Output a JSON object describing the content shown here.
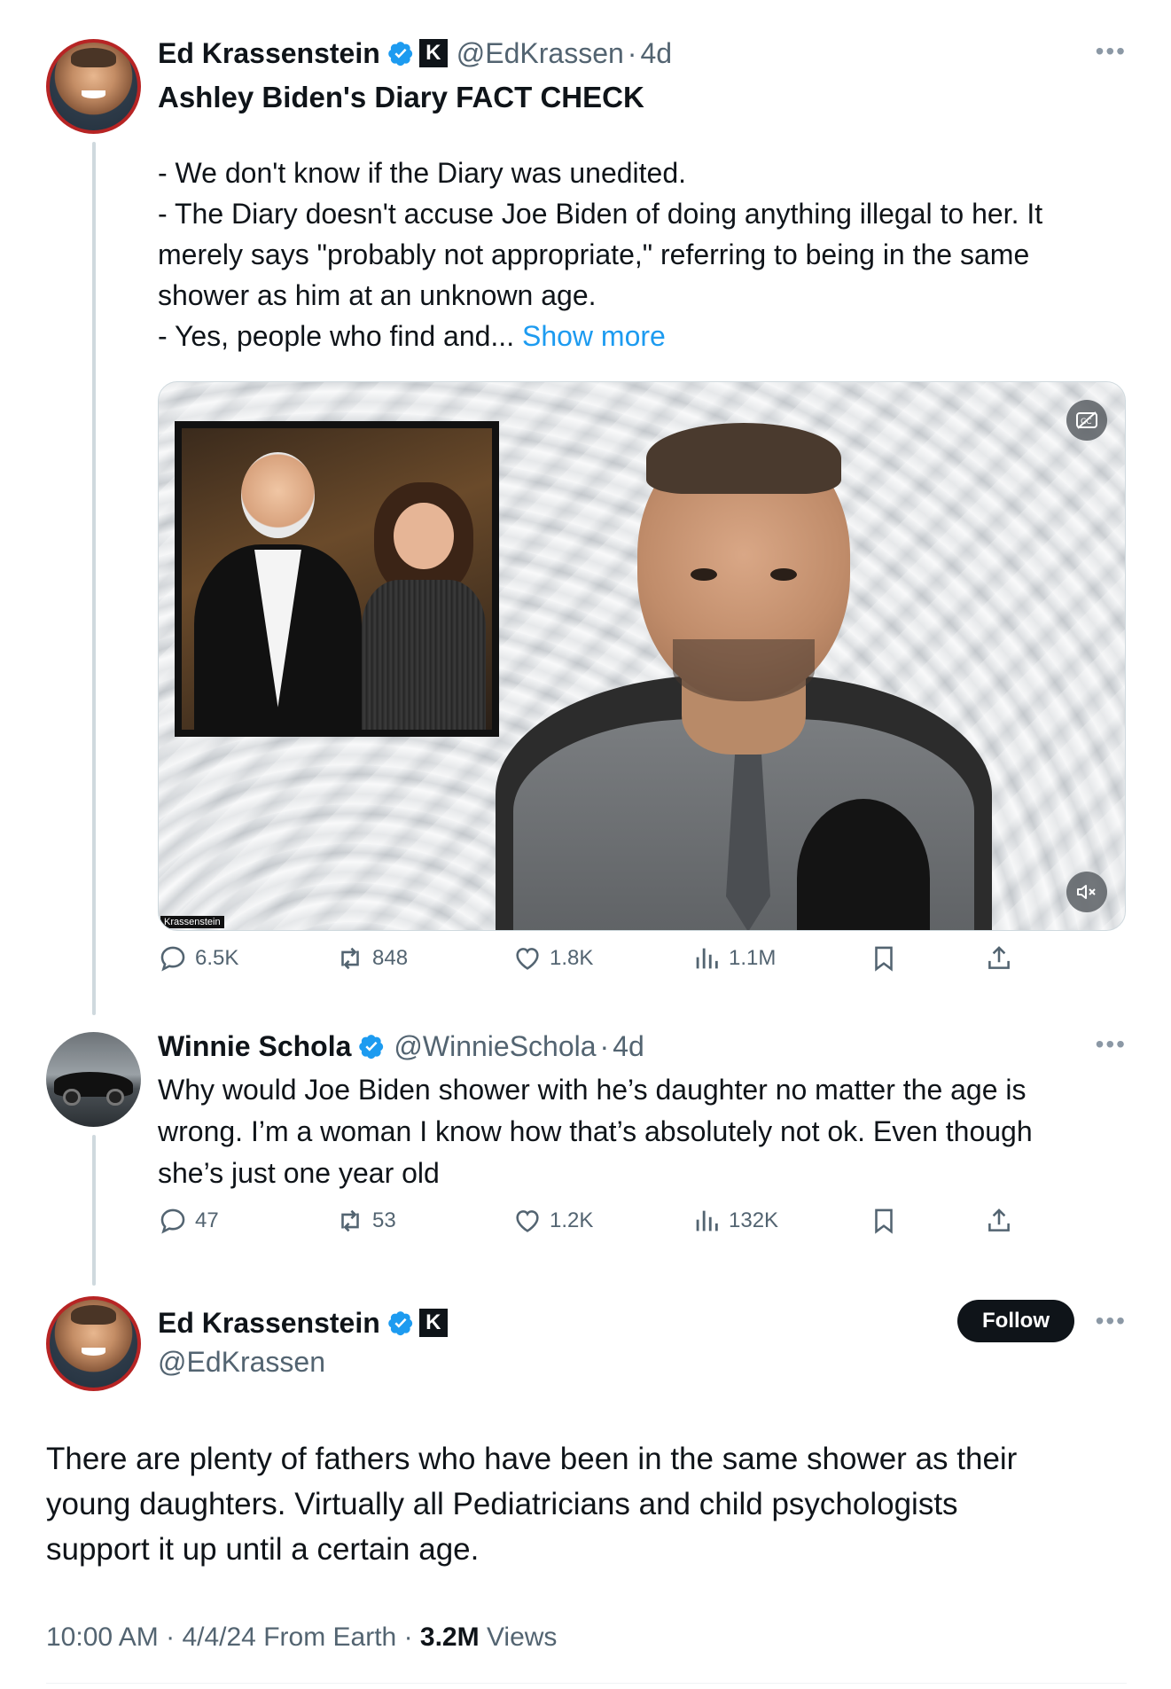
{
  "tweet1": {
    "name": "Ed Krassenstein",
    "handle": "@EdKrassen",
    "sep": "·",
    "time": "4d",
    "title": "Ashley Biden's Diary FACT CHECK",
    "body_lines": [
      "- We don't know if the Diary was unedited.",
      "- The Diary doesn't accuse Joe Biden of doing anything illegal to her. It",
      "merely says \"probably not appropriate,\" referring to being in the same",
      "shower as him at an unknown age.",
      "- Yes, people who find and... "
    ],
    "show_more": "Show more",
    "media": {
      "watermark": "Krassenstein"
    },
    "stats": {
      "replies": "6.5K",
      "reposts": "848",
      "likes": "1.8K",
      "views": "1.1M"
    }
  },
  "tweet2": {
    "name": "Winnie Schola",
    "handle": "@WinnieSchola",
    "sep": "·",
    "time": "4d",
    "body_lines": [
      "Why would Joe Biden shower with he’s daughter no matter the age is",
      "wrong. I’m a woman I know how that’s absolutely not ok. Even though",
      "she’s just one year old"
    ],
    "stats": {
      "replies": "47",
      "reposts": "53",
      "likes": "1.2K",
      "views": "132K"
    }
  },
  "main_tweet": {
    "name": "Ed Krassenstein",
    "handle": "@EdKrassen",
    "follow_label": "Follow",
    "body_lines": [
      "There are plenty of fathers who have been in the same shower as their",
      "young daughters.  Virtually all Pediatricians and child psychologists",
      "support it up until a certain age."
    ],
    "meta": {
      "time": "10:00 AM",
      "date": "4/4/24",
      "source": "From Earth",
      "views_count": "3.2M",
      "views_label": "Views"
    }
  },
  "colors": {
    "accent": "#1d9bf0",
    "muted": "#536471",
    "text": "#0f1419",
    "thread_line": "#cfd9de"
  },
  "icons": [
    "verified-icon",
    "k-badge-icon",
    "more-icon",
    "reply-icon",
    "repost-icon",
    "like-icon",
    "views-icon",
    "bookmark-icon",
    "share-icon",
    "captions-icon",
    "mute-icon"
  ]
}
